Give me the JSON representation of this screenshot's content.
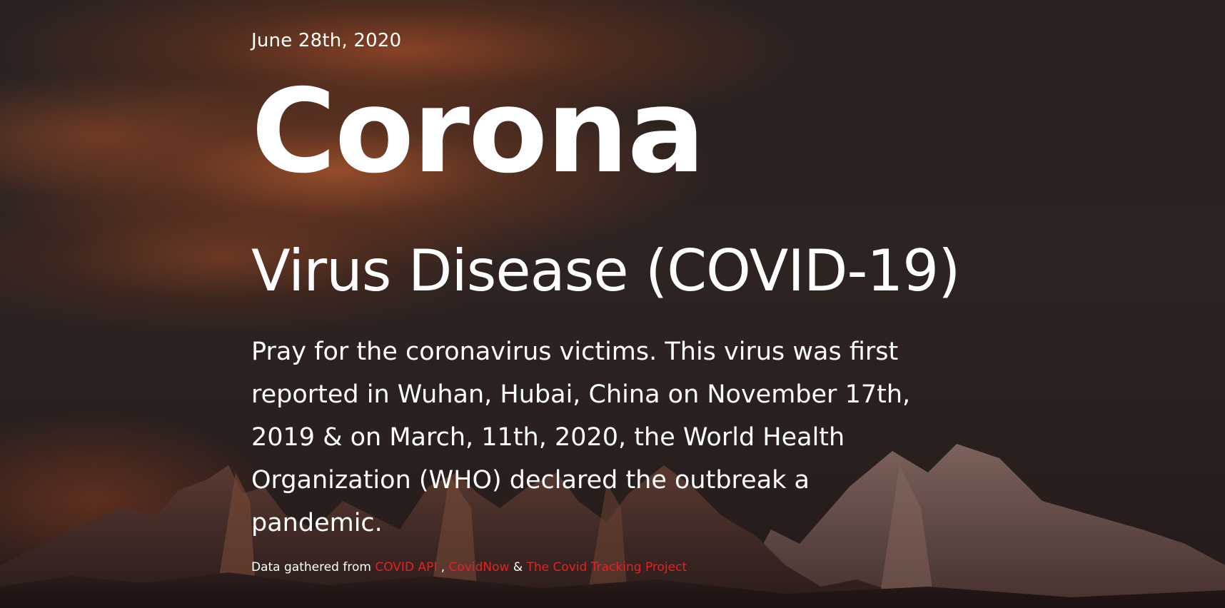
{
  "hero": {
    "date": "June 28th, 2020",
    "title": "Corona",
    "subtitle": "Virus Disease (COVID-19)",
    "description": "Pray for the coronavirus victims. This virus was first reported in Wuhan, Hubai, China on November 17th, 2019 & on March, 11th, 2020, the World Health Organization (WHO) declared the outbreak a pandemic.",
    "credits": {
      "prefix": "Data gathered from",
      "source_1": "COVID API",
      "separator_1": ",",
      "source_2": "CovidNow",
      "separator_2": "&",
      "source_3": "The Covid Tracking Project"
    }
  },
  "colors": {
    "text": "#ffffff",
    "link": "#e32222",
    "background_dark": "#2b2220",
    "cloud_orange": "#a8542c"
  }
}
